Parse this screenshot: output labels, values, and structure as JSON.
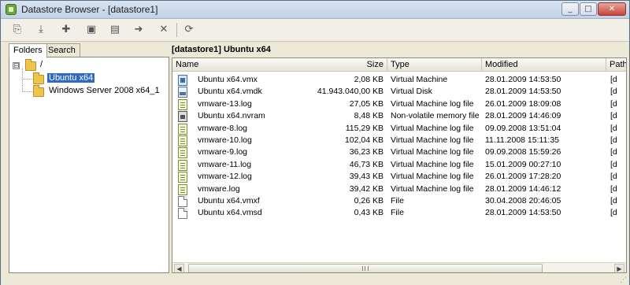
{
  "window": {
    "title": "Datastore Browser - [datastore1]",
    "buttons": {
      "minimize": "_",
      "maximize": "□",
      "close": "✕"
    }
  },
  "toolbar": {
    "items": [
      {
        "name": "upload-button",
        "icon": "upload-icon",
        "glyph": "⎘"
      },
      {
        "name": "download-button",
        "icon": "download-icon",
        "glyph": "⤓"
      },
      {
        "name": "new-folder-button",
        "icon": "new-folder-icon",
        "glyph": "✚"
      },
      {
        "name": "add-inventory-button",
        "icon": "inventory-icon",
        "glyph": "▣"
      },
      {
        "name": "copy-button",
        "icon": "copy-icon",
        "glyph": "▤"
      },
      {
        "name": "move-button",
        "icon": "move-icon",
        "glyph": "➜"
      },
      {
        "name": "delete-button",
        "icon": "delete-icon",
        "glyph": "✕"
      },
      {
        "name": "refresh-button",
        "icon": "refresh-icon",
        "glyph": "⟳"
      }
    ]
  },
  "sidebar": {
    "tabs": [
      "Folders",
      "Search"
    ],
    "active_tab": "Folders",
    "tree": {
      "root": {
        "label": "/",
        "expander": "⊟"
      },
      "children": [
        {
          "label": "Ubuntu x64",
          "selected": true
        },
        {
          "label": "Windows Server 2008 x64_1",
          "selected": false
        }
      ]
    }
  },
  "main": {
    "path": "[datastore1] Ubuntu x64",
    "columns": [
      "Name",
      "Size",
      "Type",
      "Modified",
      "Path"
    ],
    "files": [
      {
        "icon": "vm",
        "name": "Ubuntu x64.vmx",
        "size": "2,08 KB",
        "type": "Virtual Machine",
        "modified": "28.01.2009 14:53:50",
        "path": "[d"
      },
      {
        "icon": "disk",
        "name": "Ubuntu x64.vmdk",
        "size": "41.943.040,00 KB",
        "type": "Virtual Disk",
        "modified": "28.01.2009 14:53:50",
        "path": "[d"
      },
      {
        "icon": "log",
        "name": "vmware-13.log",
        "size": "27,05 KB",
        "type": "Virtual Machine log file",
        "modified": "26.01.2009 18:09:08",
        "path": "[d"
      },
      {
        "icon": "nvram",
        "name": "Ubuntu x64.nvram",
        "size": "8,48 KB",
        "type": "Non-volatile memory file",
        "modified": "28.01.2009 14:46:09",
        "path": "[d"
      },
      {
        "icon": "log",
        "name": "vmware-8.log",
        "size": "115,29 KB",
        "type": "Virtual Machine log file",
        "modified": "09.09.2008 13:51:04",
        "path": "[d"
      },
      {
        "icon": "log",
        "name": "vmware-10.log",
        "size": "102,04 KB",
        "type": "Virtual Machine log file",
        "modified": "11.11.2008 15:11:35",
        "path": "[d"
      },
      {
        "icon": "log",
        "name": "vmware-9.log",
        "size": "36,23 KB",
        "type": "Virtual Machine log file",
        "modified": "09.09.2008 15:59:26",
        "path": "[d"
      },
      {
        "icon": "log",
        "name": "vmware-11.log",
        "size": "46,73 KB",
        "type": "Virtual Machine log file",
        "modified": "15.01.2009 00:27:10",
        "path": "[d"
      },
      {
        "icon": "log",
        "name": "vmware-12.log",
        "size": "39,43 KB",
        "type": "Virtual Machine log file",
        "modified": "26.01.2009 17:28:20",
        "path": "[d"
      },
      {
        "icon": "log",
        "name": "vmware.log",
        "size": "39,42 KB",
        "type": "Virtual Machine log file",
        "modified": "28.01.2009 14:46:12",
        "path": "[d"
      },
      {
        "icon": "file",
        "name": "Ubuntu x64.vmxf",
        "size": "0,26 KB",
        "type": "File",
        "modified": "30.04.2008 20:46:05",
        "path": "[d"
      },
      {
        "icon": "file",
        "name": "Ubuntu x64.vmsd",
        "size": "0,43 KB",
        "type": "File",
        "modified": "28.01.2009 14:53:50",
        "path": "[d"
      }
    ],
    "scrollbar": {
      "left": "◀",
      "right": "▶"
    }
  }
}
